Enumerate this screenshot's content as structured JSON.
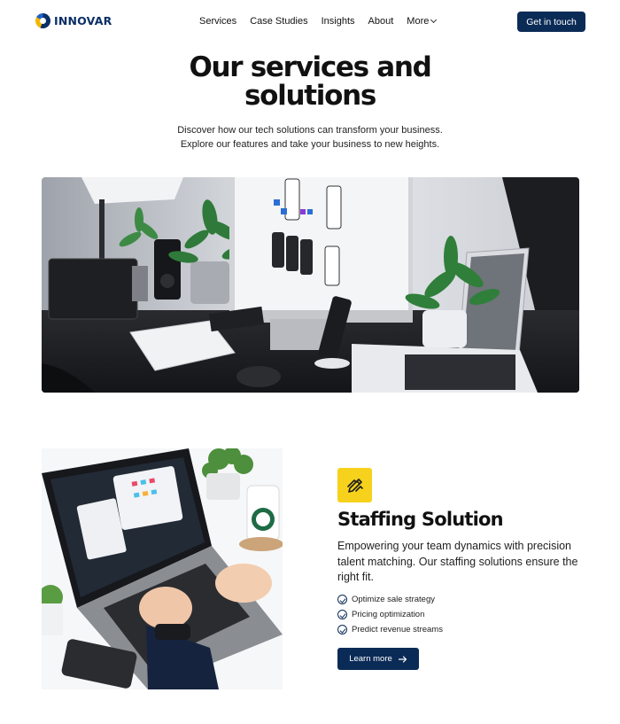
{
  "brand": {
    "name": "INNOVAR"
  },
  "nav": {
    "items": [
      {
        "label": "Services"
      },
      {
        "label": "Case Studies"
      },
      {
        "label": "Insights"
      },
      {
        "label": "About"
      },
      {
        "label": "More"
      }
    ],
    "cta_label": "Get in touch"
  },
  "hero": {
    "title_line1": "Our services and",
    "title_line2": "solutions",
    "subtitle": "Discover how our tech solutions can transform your business. Explore our features and take your business to new heights."
  },
  "feature": {
    "icon": "pencil-ruler-icon",
    "title": "Staffing Solution",
    "description": "Empowering your team dynamics with precision talent matching. Our staffing solutions ensure the right fit.",
    "bullets": [
      "Optimize sale strategy",
      "Pricing optimization",
      "Predict revenue streams"
    ],
    "button_label": "Learn more"
  },
  "colors": {
    "primary": "#0b2b57",
    "accent": "#f6d21c"
  }
}
